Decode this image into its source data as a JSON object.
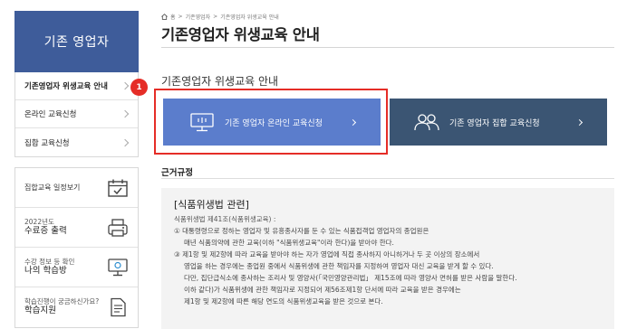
{
  "sidebar": {
    "title": "기존 영업자",
    "menu": [
      {
        "label": "기존영업자 위생교육 안내",
        "active": true
      },
      {
        "label": "온라인 교육신청",
        "active": false
      },
      {
        "label": "집합 교육신청",
        "active": false
      }
    ],
    "quick": {
      "schedule": {
        "label": "집합교육 일정보기",
        "icon": "calendar-check-icon"
      },
      "certificate": {
        "small": "2022년도",
        "big": "수료증 출력",
        "icon": "printer-icon"
      },
      "history": {
        "small": "수강 정보 등 확인",
        "big": "나의 학습방",
        "icon": "monitor-icon"
      },
      "support": {
        "small": "학습진행이 궁금하신가요?",
        "big": "학습지원",
        "icon": "document-icon"
      }
    }
  },
  "badge": {
    "number": "1",
    "color": "#e52d27"
  },
  "breadcrumb": {
    "home": "홈",
    "level1": "기존영업자",
    "level2": "기존영업자 위생교육 안내"
  },
  "page_title": "기존영업자 위생교육 안내",
  "section_title": "기존영업자 위생교육 안내",
  "cards": {
    "online": {
      "label": "기존 영업자 온라인 교육신청",
      "icon": "monitor-icon",
      "color": "#5b7dcc"
    },
    "group": {
      "label": "기존 영업자 집합 교육신청",
      "icon": "group-people-icon",
      "color": "#3b5573"
    }
  },
  "basis_title": "근거규정",
  "law": {
    "head": "[식품위생법 관련]",
    "sub": "식품위생법 제41조(식품위생교육) :",
    "lines": [
      {
        "text": "① 대통령령으로 정하는 영업자 및 유흥종사자를 둔 수 있는 식품접객업 영업자의 종업원은",
        "indent": false
      },
      {
        "text": "매년 식품의약에 관한 교육(이하 \"식품위생교육\"이라 한다)을 받아야 한다.",
        "indent": true
      },
      {
        "text": "③ 제1항 및 제2항에 따라 교육을 받아야 하는 자가 영업에 직접 종사하지 아니하거나 두 곳 이상의 장소에서",
        "indent": false
      },
      {
        "text": "영업을 하는 경우에는 종업원 중에서 식품위생에 관한 책임자를 지정하여 영업자 대신 교육을 받게 할 수 있다.",
        "indent": true
      },
      {
        "text": "다만, 집단급식소에 종사하는 조리사 및 영양사(「국민영양관리법」 제15조에 따라 영양사 면허를 받은 사람을 말한다.",
        "indent": true
      },
      {
        "text": "이하 같다)가 식품위생에 관한 책임자로 지정되어 제56조제1항 단서에 따라 교육을 받은 경우에는",
        "indent": true
      },
      {
        "text": "제1항 및 제2항에 따른 해당 연도의 식품위생교육을 받은 것으로 본다.",
        "indent": true
      }
    ]
  }
}
